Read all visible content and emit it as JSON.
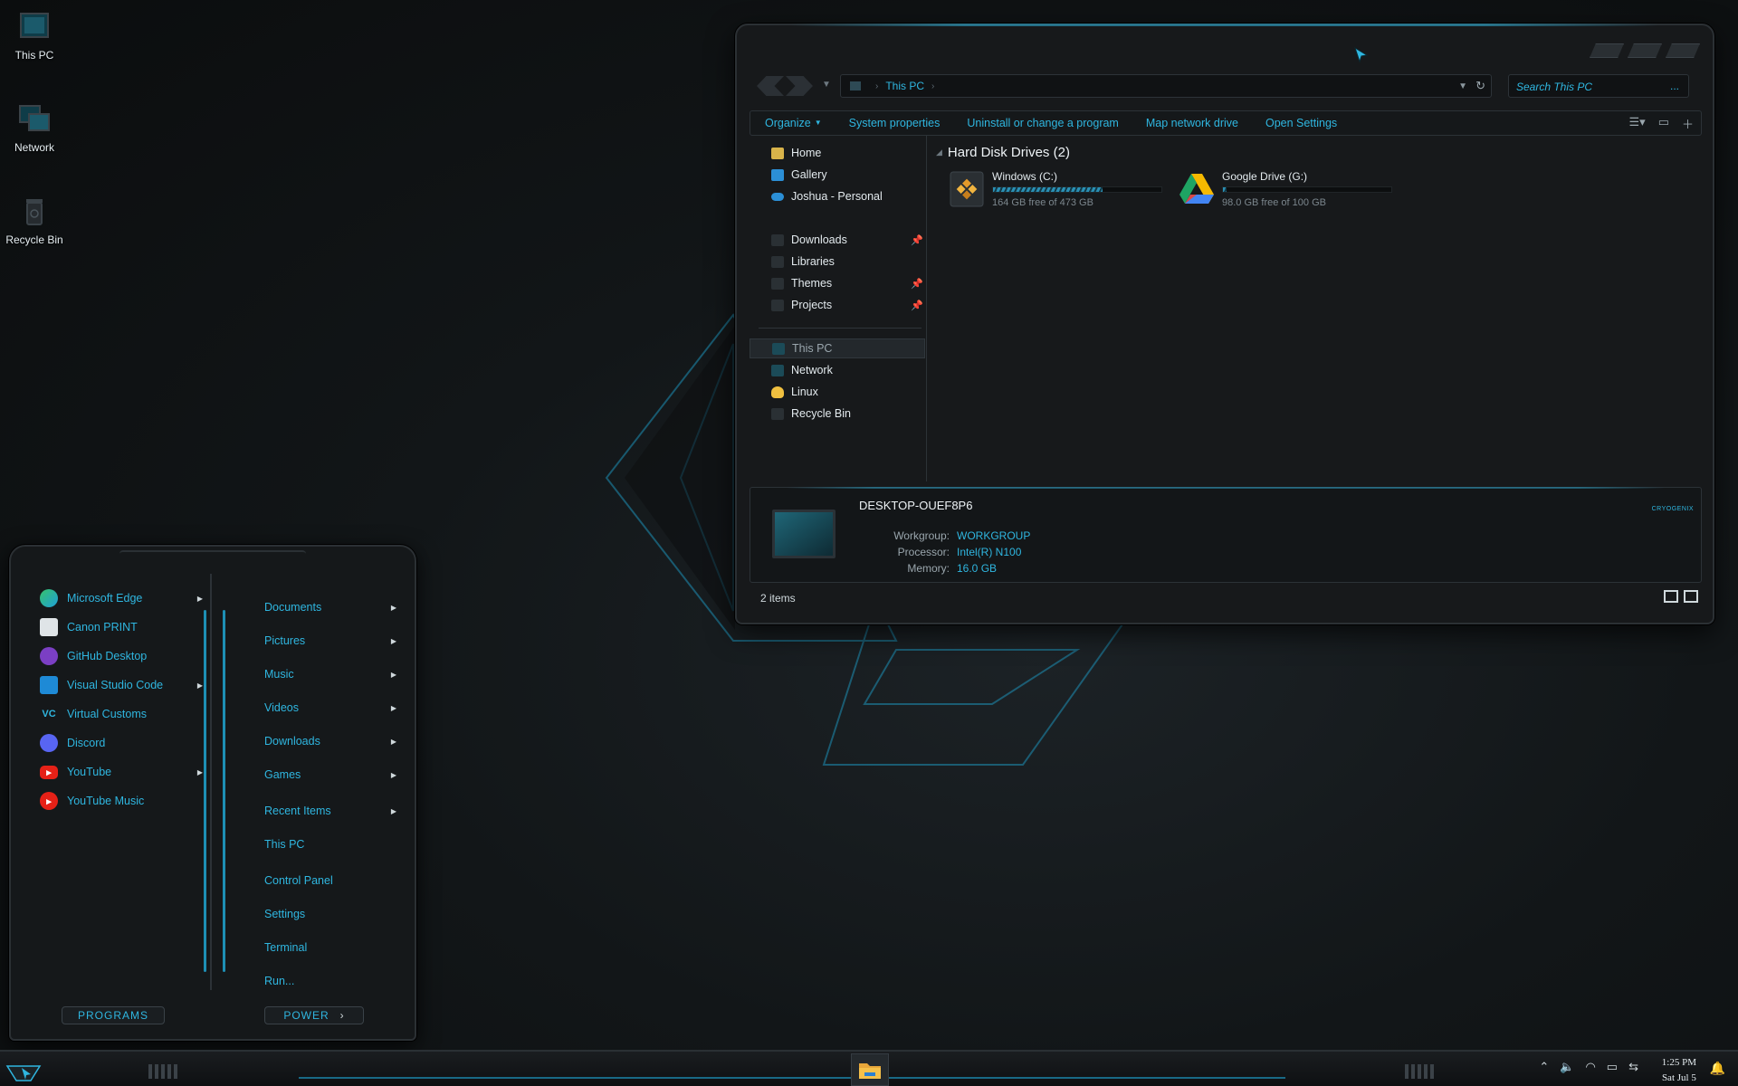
{
  "desktop": {
    "icons": [
      {
        "label": "This PC"
      },
      {
        "label": "Network"
      },
      {
        "label": "Recycle Bin"
      }
    ]
  },
  "explorer": {
    "address": {
      "crumb": "This PC"
    },
    "search": {
      "placeholder": "Search This PC",
      "dots": "..."
    },
    "toolbar": {
      "organize": "Organize",
      "system_properties": "System properties",
      "uninstall": "Uninstall or change a program",
      "map_drive": "Map network drive",
      "open_settings": "Open Settings"
    },
    "nav": {
      "home": "Home",
      "gallery": "Gallery",
      "onedrive": "Joshua - Personal",
      "downloads": "Downloads",
      "libraries": "Libraries",
      "themes": "Themes",
      "projects": "Projects",
      "thispc": "This PC",
      "network": "Network",
      "linux": "Linux",
      "recycle": "Recycle Bin"
    },
    "group_title": "Hard Disk Drives (2)",
    "drives": [
      {
        "name": "Windows (C:)",
        "free_text": "164 GB free of 473 GB",
        "used_fraction": 0.65
      },
      {
        "name": "Google Drive (G:)",
        "free_text": "98.0 GB free of 100 GB",
        "used_fraction": 0.02
      }
    ],
    "details": {
      "pc_name": "DESKTOP-OUEF8P6",
      "workgroup_label": "Workgroup:",
      "workgroup": "WORKGROUP",
      "processor_label": "Processor:",
      "processor": "Intel(R) N100",
      "memory_label": "Memory:",
      "memory": "16.0 GB",
      "brand": "CRYOGENIX"
    },
    "status": "2 items"
  },
  "startmenu": {
    "apps": [
      {
        "label": "Microsoft Edge",
        "icon": "edge-icon",
        "color": "#1fa0d8",
        "has_submenu": true
      },
      {
        "label": "Canon PRINT",
        "icon": "printer-icon",
        "color": "#dfe4e7",
        "has_submenu": false
      },
      {
        "label": "GitHub Desktop",
        "icon": "github-icon",
        "color": "#7b3fc4",
        "has_submenu": false
      },
      {
        "label": "Visual Studio Code",
        "icon": "vscode-icon",
        "color": "#1e8ad6",
        "has_submenu": true
      },
      {
        "label": "Virtual Customs",
        "icon": "virtual-customs-icon",
        "color": "#2fb6e0",
        "has_submenu": false
      },
      {
        "label": "Discord",
        "icon": "discord-icon",
        "color": "#5865f2",
        "has_submenu": false
      },
      {
        "label": "YouTube",
        "icon": "youtube-icon",
        "color": "#e62117",
        "has_submenu": true
      },
      {
        "label": "YouTube Music",
        "icon": "youtube-music-icon",
        "color": "#e62117",
        "has_submenu": false
      }
    ],
    "places": [
      {
        "label": "Documents",
        "has_submenu": true
      },
      {
        "label": "Pictures",
        "has_submenu": true
      },
      {
        "label": "Music",
        "has_submenu": true
      },
      {
        "label": "Videos",
        "has_submenu": true
      },
      {
        "label": "Downloads",
        "has_submenu": true
      },
      {
        "label": "Games",
        "has_submenu": true
      },
      {
        "label": "Recent Items",
        "has_submenu": true
      },
      {
        "label": "This PC",
        "has_submenu": false
      },
      {
        "label": "Control Panel",
        "has_submenu": false
      },
      {
        "label": "Settings",
        "has_submenu": false
      },
      {
        "label": "Terminal",
        "has_submenu": false
      },
      {
        "label": "Run...",
        "has_submenu": false
      }
    ],
    "programs_button": "PROGRAMS",
    "power_button": "POWER"
  },
  "taskbar": {
    "time": "1:25 PM",
    "date": "Sat Jul 5"
  },
  "colors": {
    "accent": "#2fb6e0",
    "accent_dark": "#1d8fb5"
  }
}
